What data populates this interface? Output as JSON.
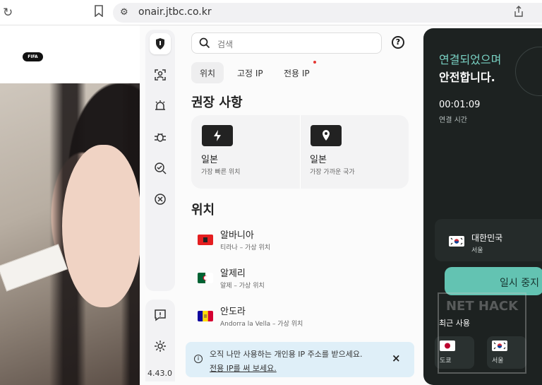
{
  "browser": {
    "url": "onair.jtbc.co.kr",
    "reload_icon": "reload-icon",
    "bookmark_icon": "bookmark-icon",
    "site_icon": "site-settings-icon",
    "share_icon": "share-icon"
  },
  "background": {
    "badge": "FIFA"
  },
  "sidebar": {
    "version": "4.43.0",
    "items": [
      {
        "icon": "shield-icon"
      },
      {
        "icon": "person-scan-icon"
      },
      {
        "icon": "alarm-icon"
      },
      {
        "icon": "bug-icon"
      },
      {
        "icon": "search-check-icon"
      },
      {
        "icon": "x-circle-icon"
      },
      {
        "icon": "feedback-icon"
      },
      {
        "icon": "settings-icon"
      }
    ]
  },
  "search": {
    "placeholder": "검색",
    "icon": "search-icon",
    "help_icon": "help-icon"
  },
  "tabs": [
    {
      "label": "위치",
      "active": true
    },
    {
      "label": "고정 IP",
      "active": false
    },
    {
      "label": "전용 IP",
      "active": false
    }
  ],
  "recommended": {
    "title": "권장 사항",
    "items": [
      {
        "label": "일본",
        "sub": "가장 빠른 위치",
        "icon": "lightning-icon"
      },
      {
        "label": "일본",
        "sub": "가장 가까운 국가",
        "icon": "location-pin-icon"
      }
    ]
  },
  "locations": {
    "title": "위치",
    "items": [
      {
        "name": "알바니아",
        "sub": "티라나 – 가상 위치",
        "flag": "albania-flag"
      },
      {
        "name": "알제리",
        "sub": "알제 – 가상 위치",
        "flag": "algeria-flag"
      },
      {
        "name": "안도라",
        "sub": "Andorra la Vella – 가상 위치",
        "flag": "andorra-flag"
      }
    ]
  },
  "notice": {
    "text": "오직 나만 사용하는 개인용 IP 주소를 받으세요.",
    "link": "전용 IP를 써 보세요.",
    "close_label": "×",
    "info_icon": "info-icon"
  },
  "connection": {
    "status_line1": "연결되었으며",
    "status_line2": "안전합니다.",
    "time": "00:01:09",
    "time_label": "연결 시간",
    "country": "대한민국",
    "city": "서울",
    "pause_label": "일시 중지",
    "recent_title": "최근 사용",
    "recent": [
      {
        "city": "도쿄",
        "flag": "japan-flag"
      },
      {
        "city": "서울",
        "flag": "korea-flag"
      }
    ]
  },
  "watermark": {
    "text": "NET HACK"
  },
  "colors": {
    "accent": "#63c3b2",
    "dark_panel": "#1d2221",
    "notice": "#dfeff8"
  }
}
